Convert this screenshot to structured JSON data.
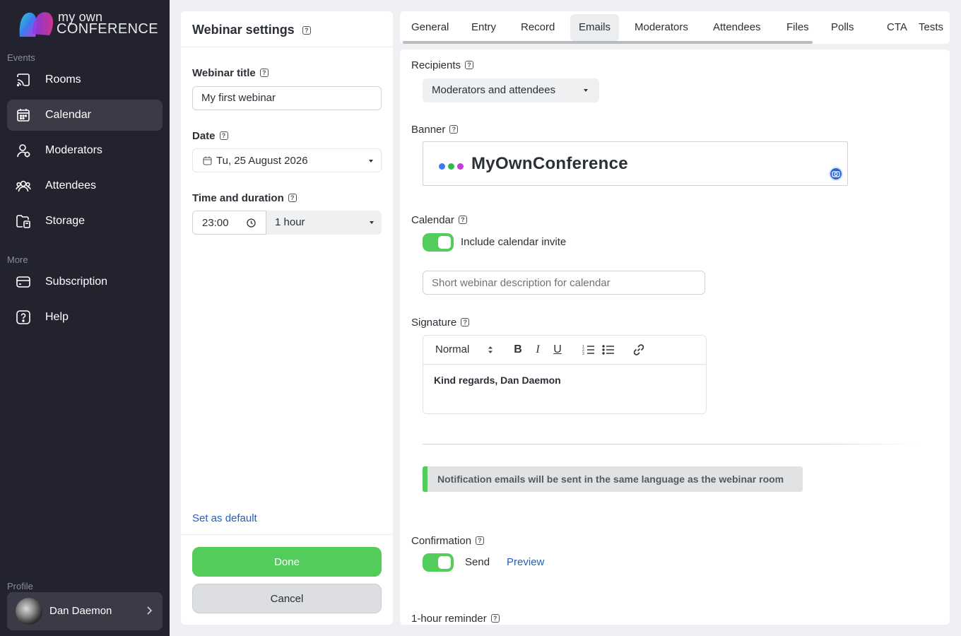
{
  "app": {
    "logo_line1": "my own",
    "logo_line2": "CONFERENCE"
  },
  "sidebar": {
    "events_label": "Events",
    "more_label": "More",
    "profile_label": "Profile",
    "items": [
      {
        "label": "Rooms",
        "icon": "cast-icon"
      },
      {
        "label": "Calendar",
        "icon": "calendar-icon",
        "active": true
      },
      {
        "label": "Moderators",
        "icon": "moderator-icon"
      },
      {
        "label": "Attendees",
        "icon": "attendees-icon"
      },
      {
        "label": "Storage",
        "icon": "folder-icon"
      }
    ],
    "more_items": [
      {
        "label": "Subscription",
        "icon": "card-icon"
      },
      {
        "label": "Help",
        "icon": "help-icon"
      }
    ],
    "profile_name": "Dan Daemon"
  },
  "settings": {
    "title": "Webinar settings",
    "title_label": "Webinar title",
    "title_value": "My first webinar",
    "date_label": "Date",
    "date_value": "Tu, 25 August 2026",
    "time_label": "Time and duration",
    "time_value": "23:00",
    "duration_value": "1 hour",
    "set_default": "Set as default",
    "done": "Done",
    "cancel": "Cancel"
  },
  "tabs": [
    "General",
    "Entry",
    "Record",
    "Emails",
    "Moderators",
    "Attendees",
    "Files",
    "Polls",
    "CTA",
    "Tests"
  ],
  "active_tab": "Emails",
  "emails": {
    "recipients_label": "Recipients",
    "recipients_value": "Moderators and attendees",
    "banner_label": "Banner",
    "banner_brand": "MyOwnConference",
    "calendar_label": "Calendar",
    "calendar_toggle_label": "Include calendar invite",
    "calendar_desc_placeholder": "Short webinar description for calendar",
    "signature_label": "Signature",
    "signature_format": "Normal",
    "signature_text": "Kind regards, Dan Daemon",
    "notice": "Notification emails will be sent in the same language as the webinar room",
    "confirmation_label": "Confirmation",
    "confirmation_send": "Send",
    "confirmation_preview": "Preview",
    "reminder_label": "1-hour reminder"
  },
  "colors": {
    "sidebar_bg": "#22232f",
    "accent_green": "#52cc5a",
    "link_blue": "#1f5fbf"
  }
}
